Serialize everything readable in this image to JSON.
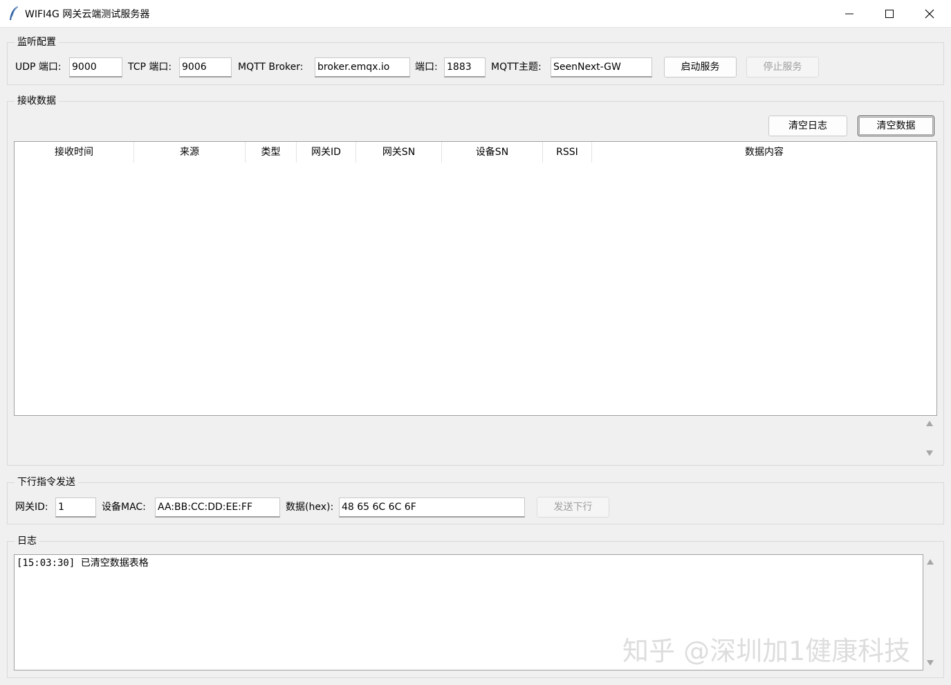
{
  "window": {
    "title": "WIFI4G 网关云端测试服务器"
  },
  "listen": {
    "legend": "监听配置",
    "udp_label": "UDP 端口:",
    "udp_value": "9000",
    "tcp_label": "TCP 端口:",
    "tcp_value": "9006",
    "broker_label": "MQTT Broker:",
    "broker_value": "broker.emqx.io",
    "port_label": "端口:",
    "port_value": "1883",
    "topic_label": "MQTT主题:",
    "topic_value": "SeenNext-GW",
    "start_label": "启动服务",
    "stop_label": "停止服务"
  },
  "receive": {
    "legend": "接收数据",
    "clear_log_label": "清空日志",
    "clear_data_label": "清空数据",
    "columns": [
      "接收时间",
      "来源",
      "类型",
      "网关ID",
      "网关SN",
      "设备SN",
      "RSSI",
      "数据内容"
    ]
  },
  "downlink": {
    "legend": "下行指令发送",
    "gw_label": "网关ID:",
    "gw_value": "1",
    "mac_label": "设备MAC:",
    "mac_value": "AA:BB:CC:DD:EE:FF",
    "data_label": "数据(hex):",
    "data_value": "48 65 6C 6C 6F",
    "send_label": "发送下行"
  },
  "log": {
    "legend": "日志",
    "lines": "[15:03:30] 已清空数据表格"
  },
  "watermark": "知乎 @深圳加1健康科技"
}
